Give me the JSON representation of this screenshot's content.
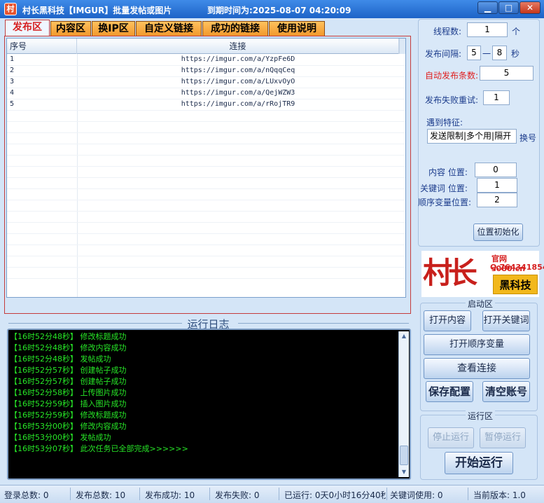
{
  "window": {
    "icon_char": "村",
    "title": "村长黑科技【IMGUR】批量发帖或图片",
    "expire": "到期时间为:2025-08-07 04:20:09",
    "btn_min": "▁",
    "btn_max": "□",
    "btn_close": "✕"
  },
  "tabs": [
    "发布区",
    "内容区",
    "换IP区",
    "自定义链接",
    "成功的链接",
    "使用说明"
  ],
  "grid": {
    "headers": [
      "序号",
      "连接"
    ],
    "rows": [
      {
        "num": "1",
        "url": "https://imgur.com/a/YzpFe6D"
      },
      {
        "num": "2",
        "url": "https://imgur.com/a/nQqqCeq"
      },
      {
        "num": "3",
        "url": "https://imgur.com/a/LUxvOyO"
      },
      {
        "num": "4",
        "url": "https://imgur.com/a/QejWZW3"
      },
      {
        "num": "5",
        "url": "https://imgur.com/a/rRojTR9"
      }
    ]
  },
  "log": {
    "title": "运行日志",
    "lines": [
      "【16时52分48秒】 修改标题成功",
      "【16时52分48秒】 修改内容成功",
      "【16时52分48秒】 发帖成功",
      "【16时52分57秒】 创建帖子成功",
      "【16时52分57秒】 创建帖子成功",
      "【16时52分58秒】 上传图片成功",
      "【16时52分59秒】 插入图片成功",
      "【16时52分59秒】 修改标题成功",
      "【16时53分00秒】 修改内容成功",
      "【16时53分00秒】 发帖成功",
      "【16时53分07秒】 此次任务已全部完成>>>>>>"
    ]
  },
  "settings": {
    "threads_label": "线程数:",
    "threads_value": "1",
    "threads_unit": "个",
    "interval_label": "发布间隔:",
    "interval_from": "5",
    "interval_sep": "一",
    "interval_to": "8",
    "interval_unit": "秒",
    "auto_count_label": "自动发布条数:",
    "auto_count_value": "5",
    "retry_label": "发布失败重试:",
    "retry_value": "1",
    "feature_label": "遇到特征:",
    "feature_value": "发送限制|多个用|隔开",
    "switch_link": "换号",
    "content_pos_label": "内容 位置:",
    "content_pos_value": "0",
    "keyword_pos_label": "关键词 位置:",
    "keyword_pos_value": "1",
    "order_pos_label": "顺序变量位置:",
    "order_pos_value": "2",
    "reset_btn": "位置初始化"
  },
  "logo": {
    "glyph": "村长",
    "url": "官网 s080.cn",
    "qq": "Q.764341854",
    "badge": "黑科技"
  },
  "start_group": {
    "title": "启动区",
    "open_content": "打开内容",
    "open_keywords": "打开关键词",
    "open_order": "打开顺序变量",
    "view_links": "查看连接",
    "save_config": "保存配置",
    "clear_accounts": "清空账号"
  },
  "run_group": {
    "title": "运行区",
    "stop": "停止运行",
    "pause": "暂停运行",
    "start": "开始运行"
  },
  "status": {
    "login_total": "登录总数:  0",
    "post_total": "发布总数:  10",
    "post_success": "发布成功:  10",
    "post_fail": "发布失败:  0",
    "elapsed": "已运行: 0天0小时16分40秒",
    "keywords_used": "关键词使用:  0",
    "version": "当前版本:  1.0"
  }
}
